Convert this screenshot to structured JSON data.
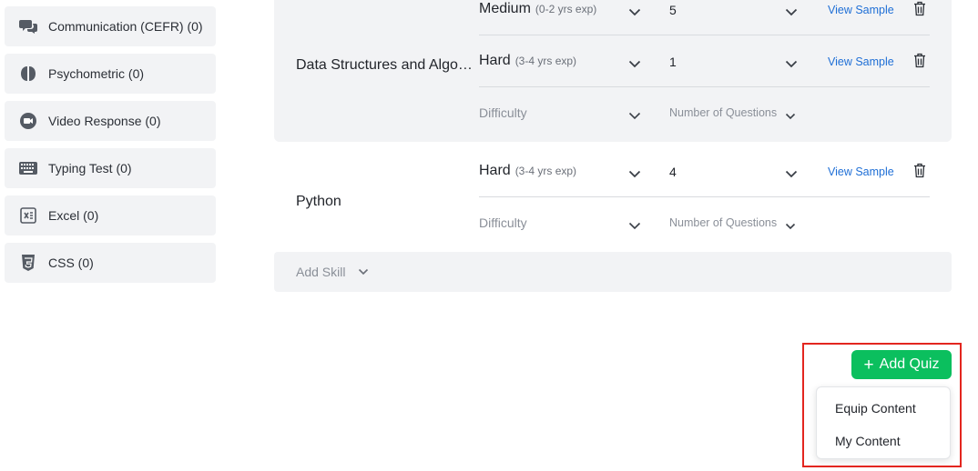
{
  "sidebar": {
    "items": [
      {
        "label": "Communication (CEFR) (0)",
        "icon": "chat-bubbles-icon"
      },
      {
        "label": "Psychometric (0)",
        "icon": "brain-icon"
      },
      {
        "label": "Video Response (0)",
        "icon": "video-camera-icon"
      },
      {
        "label": "Typing Test (0)",
        "icon": "keyboard-icon"
      },
      {
        "label": "Excel (0)",
        "icon": "excel-icon"
      },
      {
        "label": "CSS (0)",
        "icon": "css-icon"
      }
    ]
  },
  "skills": [
    {
      "name": "Data Structures and Algorithms",
      "rows": [
        {
          "difficulty": "Medium",
          "experience": "(0-2 yrs exp)",
          "questions": "5",
          "view_sample": "View Sample"
        },
        {
          "difficulty": "Hard",
          "experience": "(3-4 yrs exp)",
          "questions": "1",
          "view_sample": "View Sample"
        }
      ],
      "placeholder": {
        "difficulty": "Difficulty",
        "questions": "Number of Questions"
      }
    },
    {
      "name": "Python",
      "rows": [
        {
          "difficulty": "Hard",
          "experience": "(3-4 yrs exp)",
          "questions": "4",
          "view_sample": "View Sample"
        }
      ],
      "placeholder": {
        "difficulty": "Difficulty",
        "questions": "Number of Questions"
      }
    }
  ],
  "add_skill": {
    "label": "Add Skill"
  },
  "add_quiz": {
    "label": "Add Quiz"
  },
  "quiz_menu": {
    "items": [
      "Equip Content",
      "My Content"
    ]
  },
  "colors": {
    "accent_green": "#0bbf5e",
    "link_blue": "#1f6fd6",
    "highlight_red": "#e3261f",
    "panel_grey": "#f2f3f5"
  }
}
